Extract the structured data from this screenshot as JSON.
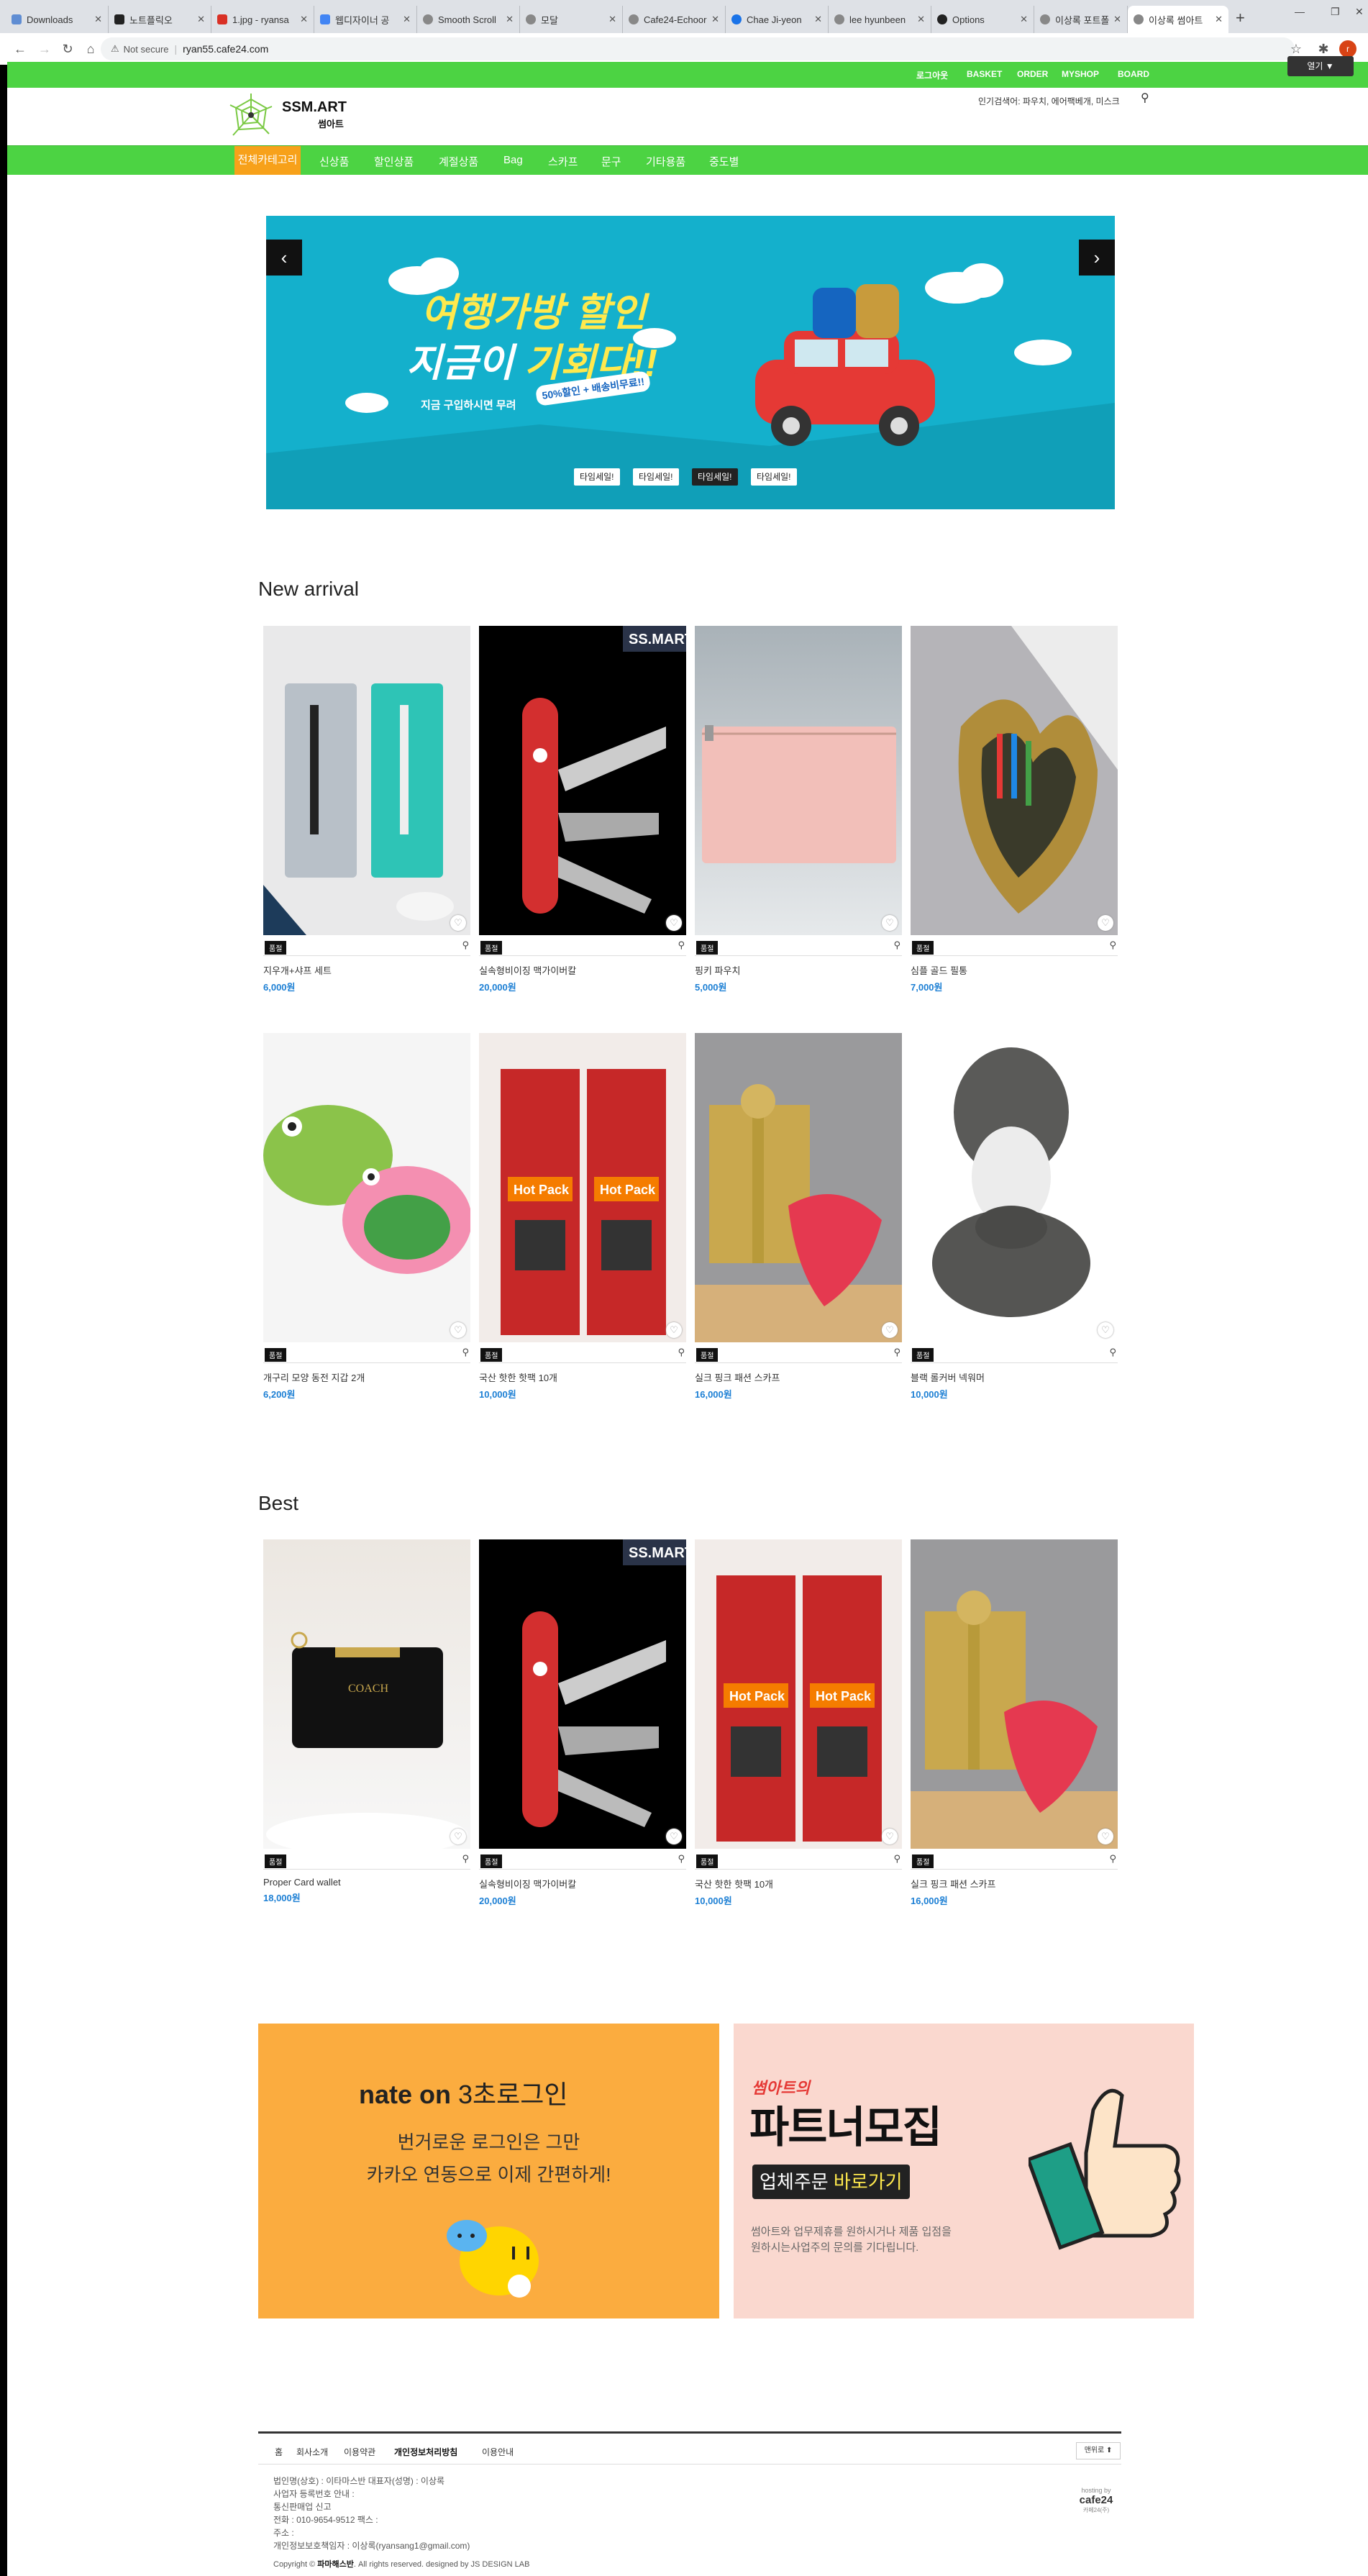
{
  "browser": {
    "tabs": [
      {
        "label": "Downloads",
        "color": "#5f8dd3"
      },
      {
        "label": "노트플릭오",
        "color": "#222"
      },
      {
        "label": "1.jpg - ryansa",
        "color": "#d93025"
      },
      {
        "label": "웹디자이너 공",
        "color": "#4285f4"
      },
      {
        "label": "Smooth Scroll",
        "color": "#5f6368"
      },
      {
        "label": "모달",
        "color": "#5f6368"
      },
      {
        "label": "Cafe24-Echoor",
        "color": "#5f6368"
      },
      {
        "label": "Chae Ji-yeon",
        "color": "#1a73e8"
      },
      {
        "label": "lee hyunbeen",
        "color": "#5f6368"
      },
      {
        "label": "Options",
        "color": "#222"
      },
      {
        "label": "이상록 포트폴",
        "color": "#5f6368"
      },
      {
        "label": "이상록 썸아트",
        "color": "#5f6368"
      }
    ],
    "new_tab": "+",
    "not_secure": "Not secure",
    "url": "ryan55.cafe24.com",
    "profile_initial": "r"
  },
  "site": {
    "top_links": [
      "로그아웃",
      "BASKET",
      "ORDER",
      "MYSHOP",
      "BOARD"
    ],
    "open_button": "열기 ▼",
    "logo_en": "SSM.ART",
    "logo_ko": "썸아트",
    "popular_search": "인기검색어: 파우치, 에어팩베개, 미스크",
    "gnb": [
      "전체카테고리",
      "신상품",
      "할인상품",
      "계절상품",
      "Bag",
      "스카프",
      "문구",
      "기타용품",
      "중도별"
    ],
    "banner": {
      "headline_1": "여행가방 할인",
      "headline_2a": "지금이 ",
      "headline_2b": "기회다!!",
      "sub": "지금 구입하시면 무려",
      "sale": "50%할인 + 배송비무료!!",
      "tabs": [
        "타임세일!",
        "타임세일!",
        "타임세일!",
        "타임세일!"
      ]
    },
    "new_arrival_title": "New arrival",
    "best_title": "Best",
    "badge": "품절",
    "products_new": [
      {
        "name": "지우개+샤프 세트",
        "price": "6,000원"
      },
      {
        "name": "실속형비이징 맥가이버칼",
        "price": "20,000원"
      },
      {
        "name": "핑키 파우치",
        "price": "5,000원"
      },
      {
        "name": "심플 골드 필통",
        "price": "7,000원"
      },
      {
        "name": "개구리 모양 동전 지갑 2개",
        "price": "6,200원"
      },
      {
        "name": "국산 핫한 핫팩 10개",
        "price": "10,000원"
      },
      {
        "name": "실크 핑크 패션 스카프",
        "price": "16,000원"
      },
      {
        "name": "블랙 롤커버 넥워머",
        "price": "10,000원"
      }
    ],
    "products_best": [
      {
        "name": "Proper Card wallet",
        "price": "18,000원"
      },
      {
        "name": "실속형비이징 맥가이버칼",
        "price": "20,000원"
      },
      {
        "name": "국산 핫한 핫팩 10개",
        "price": "10,000원"
      },
      {
        "name": "실크 핑크 패션 스카프",
        "price": "16,000원"
      }
    ],
    "promo_left": {
      "title_a": "nate on ",
      "title_b": "3초로그인",
      "line1": "번거로운 로그인은 그만",
      "line2": "카카오 연동으로 이제 간편하게!"
    },
    "promo_right": {
      "small": "썸아트의",
      "big": "파트너모집",
      "btn_a": "업체주문 ",
      "btn_b": "바로가기",
      "desc1": "썸아트와 업무제휴를 원하시거나 제품 입점을",
      "desc2": "원하시는사업주의 문의를 기다립니다."
    },
    "footer": {
      "links": [
        "홈",
        "회사소개",
        "이용약관",
        "개인정보처리방침",
        "이용안내"
      ],
      "top_button": "맨위로 ⬆",
      "info": [
        "법인명(상호) : 이타마스반        대표자(성명) : 이상록",
        "사업자 등록번호 안내 :",
        "통신판매업 신고",
        "전화 : 010-9654-9512       팩스 :",
        "주소 :",
        "개인정보보호책임자 : 이상록(ryansang1@gmail.com)"
      ],
      "copyright_a": "Copyright © ",
      "copyright_b": "파마해스반",
      "copyright_c": ". All rights reserved. designed by JS DESIGN LAB",
      "hosting_1": "hosting by",
      "hosting_2": "cafe24",
      "hosting_3": "카페24(주)"
    }
  }
}
